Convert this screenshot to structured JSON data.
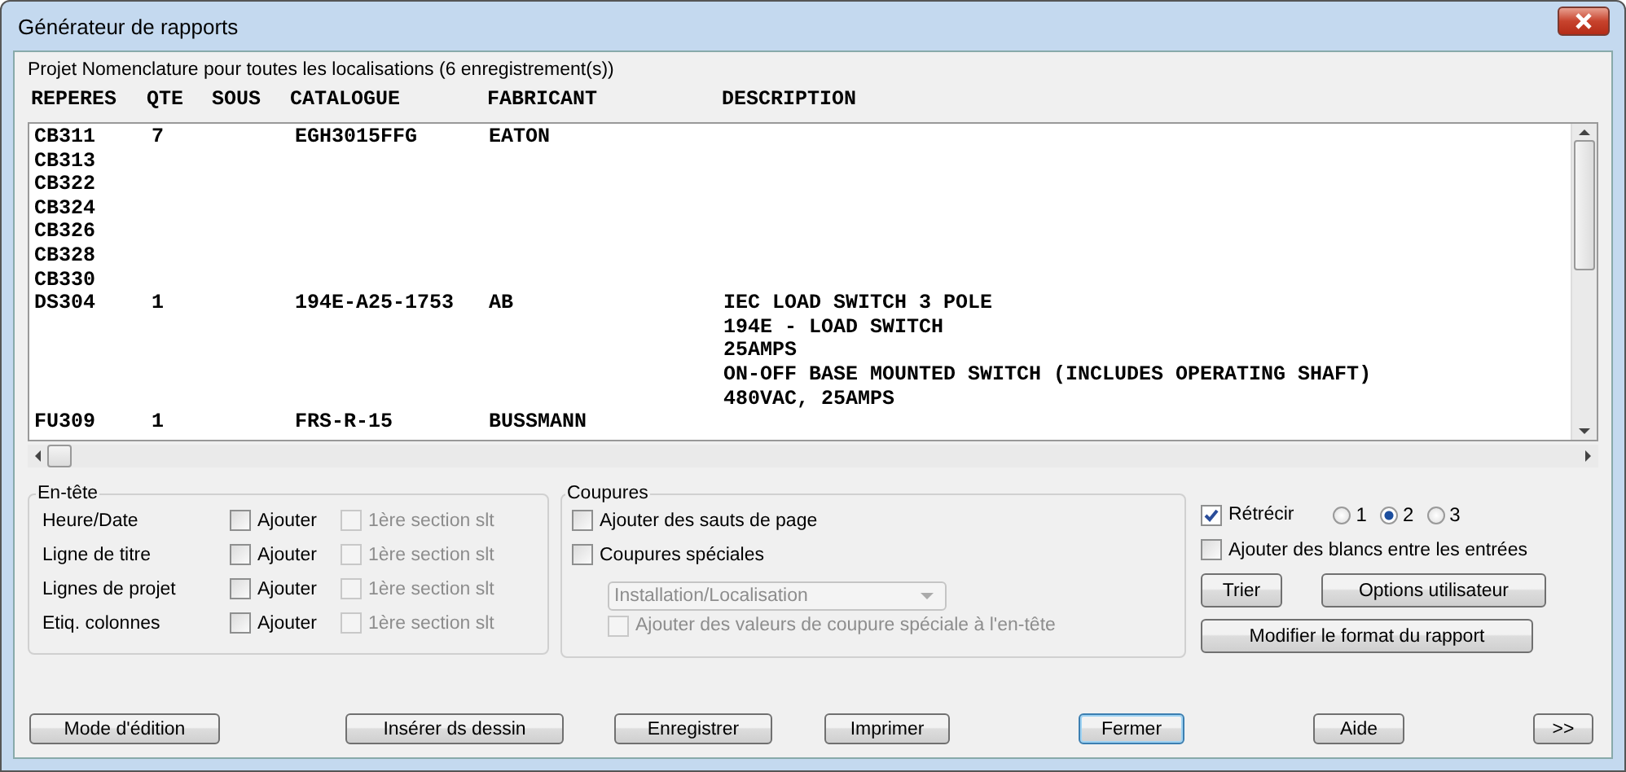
{
  "window": {
    "title": "Générateur de rapports"
  },
  "project_line": "Projet Nomenclature pour toutes les localisations (6 enregistrement(s))",
  "report": {
    "columns": [
      "REPERES",
      "QTE",
      "SOUS",
      "CATALOGUE",
      "FABRICANT",
      "DESCRIPTION"
    ],
    "rows": [
      {
        "repere": "CB311",
        "qte": "7",
        "catalogue": "EGH3015FFG",
        "fabricant": "EATON",
        "description": []
      },
      {
        "repere": "CB313",
        "description": []
      },
      {
        "repere": "CB322",
        "description": []
      },
      {
        "repere": "CB324",
        "description": []
      },
      {
        "repere": "CB326",
        "description": []
      },
      {
        "repere": "CB328",
        "description": []
      },
      {
        "repere": "CB330",
        "description": []
      },
      {
        "repere": "DS304",
        "qte": "1",
        "catalogue": "194E-A25-1753",
        "fabricant": "AB",
        "description": [
          "IEC LOAD SWITCH 3 POLE",
          "194E - LOAD SWITCH",
          "25AMPS",
          "ON-OFF BASE MOUNTED SWITCH (INCLUDES OPERATING SHAFT)",
          "480VAC, 25AMPS"
        ]
      },
      {
        "repere": "FU309",
        "qte": "1",
        "catalogue": "FRS-R-15",
        "fabricant": "BUSSMANN",
        "description": []
      }
    ]
  },
  "entete": {
    "label": "En-tête",
    "rows": [
      {
        "label": "Heure/Date",
        "add": {
          "label": "Ajouter",
          "checked": false
        },
        "first": {
          "label": "1ère section slt",
          "checked": false,
          "disabled": true
        }
      },
      {
        "label": "Ligne de titre",
        "add": {
          "label": "Ajouter",
          "checked": false
        },
        "first": {
          "label": "1ère section slt",
          "checked": false,
          "disabled": true
        }
      },
      {
        "label": "Lignes de projet",
        "add": {
          "label": "Ajouter",
          "checked": false
        },
        "first": {
          "label": "1ère section slt",
          "checked": false,
          "disabled": true
        }
      },
      {
        "label": "Etiq. colonnes",
        "add": {
          "label": "Ajouter",
          "checked": false
        },
        "first": {
          "label": "1ère section slt",
          "checked": false,
          "disabled": true
        }
      }
    ]
  },
  "coupures": {
    "label": "Coupures",
    "page_breaks": {
      "label": "Ajouter des sauts de page",
      "checked": false,
      "disabled": false
    },
    "special": {
      "label": "Coupures spéciales",
      "checked": false,
      "disabled": false
    },
    "dropdown": {
      "value": "Installation/Localisation",
      "disabled": true
    },
    "special_header": {
      "label": "Ajouter des valeurs de coupure spéciale à l'en-tête",
      "checked": false,
      "disabled": true
    }
  },
  "options": {
    "shrink": {
      "label": "Rétrécir",
      "checked": true,
      "disabled": false
    },
    "radios": [
      {
        "label": "1",
        "selected": false
      },
      {
        "label": "2",
        "selected": true
      },
      {
        "label": "3",
        "selected": false
      }
    ],
    "blanks": {
      "label": "Ajouter des blancs entre les entrées",
      "checked": false,
      "disabled": false
    },
    "buttons": [
      "Trier",
      "Options utilisateur"
    ],
    "format_button": "Modifier le format du rapport"
  },
  "footer_buttons": [
    {
      "label": "Mode d'édition",
      "default": false
    },
    {
      "label": "Insérer ds dessin",
      "default": false
    },
    {
      "label": "Enregistrer",
      "default": false
    },
    {
      "label": "Imprimer",
      "default": false
    },
    {
      "label": "Fermer",
      "default": true
    },
    {
      "label": "Aide",
      "default": false
    },
    {
      "label": ">>",
      "default": false
    }
  ]
}
